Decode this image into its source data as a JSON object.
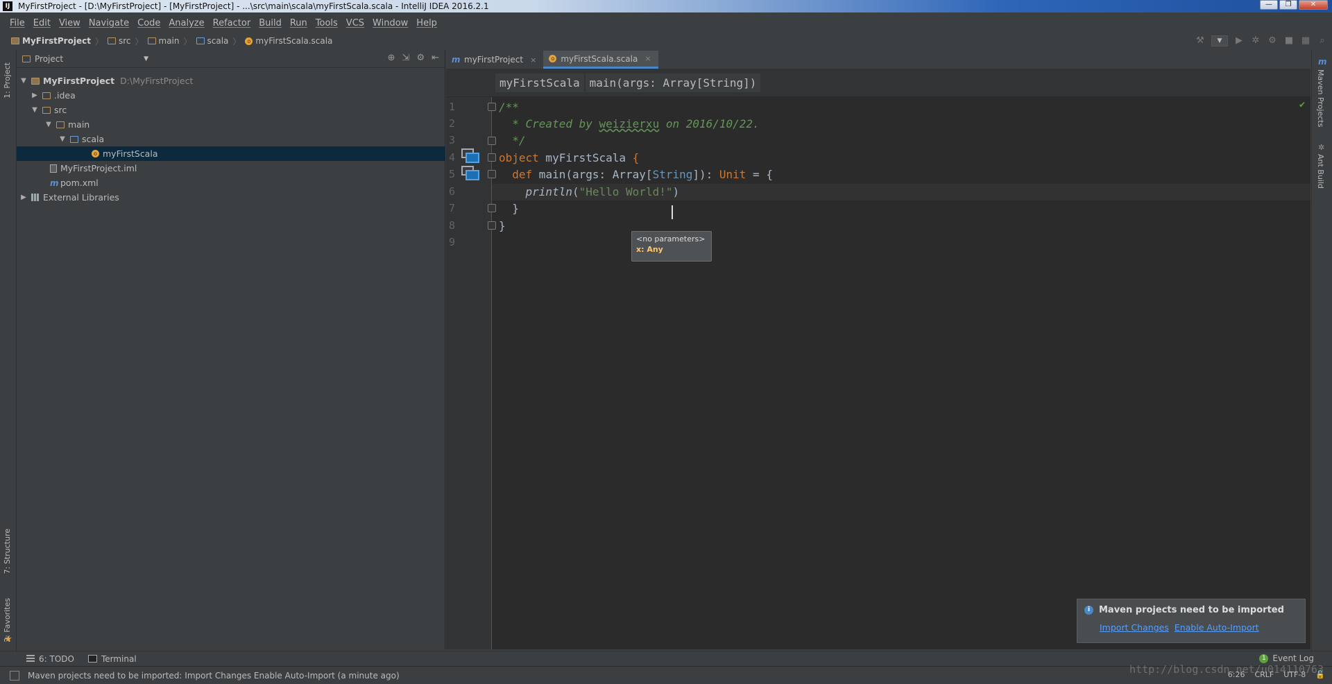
{
  "window": {
    "title": "MyFirstProject - [D:\\MyFirstProject] - [MyFirstProject] - ...\\src\\main\\scala\\myFirstScala.scala - IntelliJ IDEA 2016.2.1",
    "app_icon": "IJ"
  },
  "menu": [
    "File",
    "Edit",
    "View",
    "Navigate",
    "Code",
    "Analyze",
    "Refactor",
    "Build",
    "Run",
    "Tools",
    "VCS",
    "Window",
    "Help"
  ],
  "navbar": {
    "crumbs": [
      "MyFirstProject",
      "src",
      "main",
      "scala",
      "myFirstScala.scala"
    ]
  },
  "left_strip": {
    "project_tab": "1: Project",
    "structure_tab": "7: Structure",
    "favorites_tab": "2: Favorites"
  },
  "project_panel": {
    "title": "Project",
    "tree": [
      {
        "label": "MyFirstProject",
        "path": "D:\\MyFirstProject"
      },
      {
        "label": ".idea"
      },
      {
        "label": "src"
      },
      {
        "label": "main"
      },
      {
        "label": "scala"
      },
      {
        "label": "myFirstScala"
      },
      {
        "label": "MyFirstProject.iml"
      },
      {
        "label": "pom.xml"
      },
      {
        "label": "External Libraries"
      }
    ]
  },
  "editor": {
    "tabs": [
      {
        "label": "myFirstProject"
      },
      {
        "label": "myFirstScala.scala"
      }
    ],
    "breadcrumbs": [
      "myFirstScala",
      "main(args: Array[String])"
    ],
    "line_numbers": [
      "1",
      "2",
      "3",
      "4",
      "5",
      "6",
      "7",
      "8",
      "9"
    ],
    "code": {
      "l1": "/**",
      "l2_a": "  * Created by ",
      "l2_author": "weizierxu",
      "l2_b": " on 2016/10/22.",
      "l3": "  */",
      "l4_kw": "object",
      "l4_name": " myFirstScala ",
      "l4_brace": "{",
      "l5_kw": "  def",
      "l5_a": " main(args: Array[",
      "l5_type": "String",
      "l5_b": "]): ",
      "l5_unit": "Unit",
      "l5_c": " = {",
      "l6_fn": "    println",
      "l6_a": "(",
      "l6_str": "\"Hello World!\"",
      "l6_b": ")",
      "l7": "  }",
      "l8": "}",
      "l9": ""
    },
    "tooltip": {
      "line1": "<no parameters>",
      "line2": "x: Any"
    }
  },
  "right_strip": {
    "maven": "Maven Projects",
    "ant": "Ant Build"
  },
  "notification": {
    "title": "Maven projects need to be imported",
    "link1": "Import Changes",
    "link2": "Enable Auto-Import"
  },
  "bottom_tools": {
    "todo": "6: TODO",
    "terminal": "Terminal",
    "event_log": "Event Log"
  },
  "status": {
    "message": "Maven projects need to be imported: Import Changes Enable Auto-Import (a minute ago)",
    "position": "6:26",
    "line_sep": "CRLF",
    "encoding": "UTF-8"
  },
  "watermark": "http://blog.csdn.net/u014110763"
}
